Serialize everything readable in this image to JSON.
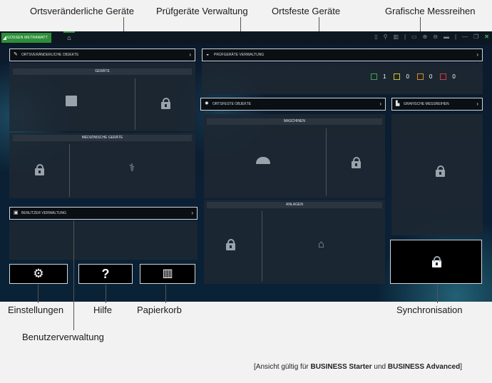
{
  "callouts": {
    "ortsveraenderliche": "Ortsveränderliche Geräte",
    "pruefgeraete": "Prüfgeräte Verwaltung",
    "ortsfeste": "Ortsfeste Geräte",
    "grafische": "Grafische Messreihen",
    "einstellungen": "Einstellungen",
    "hilfe": "Hilfe",
    "papierkorb": "Papierkorb",
    "synchronisation": "Synchronisation",
    "benutzerverwaltung": "Benutzerverwaltung"
  },
  "caption": {
    "prefix": "[Ansicht gültig für ",
    "starter": "BUSINESS Starter",
    "middle": " und ",
    "advanced": "BUSINESS Advanced",
    "suffix": "]"
  },
  "app": {
    "logo": "GOSSEN METRAWATT",
    "home_icon": "home-icon",
    "colors": {
      "brand_green": "#2e8f3a",
      "background": "#0b1f33"
    },
    "panels": {
      "ortsveraenderliche_objekte": "ORTSVERÄNDERLICHE OBJEKTE",
      "geraete": "GERÄTE",
      "medizinische_geraete": "MEDIZINISCHE GERÄTE",
      "benutzer_verwaltung": "BENUTZER VERWALTUNG",
      "pruefgeraete_verwaltung": "PRÜFGERÄTE VERWALTUNG",
      "ortsfeste_objekte": "ORTSFESTE OBJEKTE",
      "maschinen": "MASCHINEN",
      "anlagen": "ANLAGEN",
      "grafische_messreihen": "GRAFISCHE MESSREIHEN"
    },
    "counters": [
      {
        "value": "1",
        "color": "#3fa34d"
      },
      {
        "value": "0",
        "color": "#d4c21f"
      },
      {
        "value": "0",
        "color": "#e08a1e"
      },
      {
        "value": "0",
        "color": "#d33a3a"
      }
    ]
  }
}
